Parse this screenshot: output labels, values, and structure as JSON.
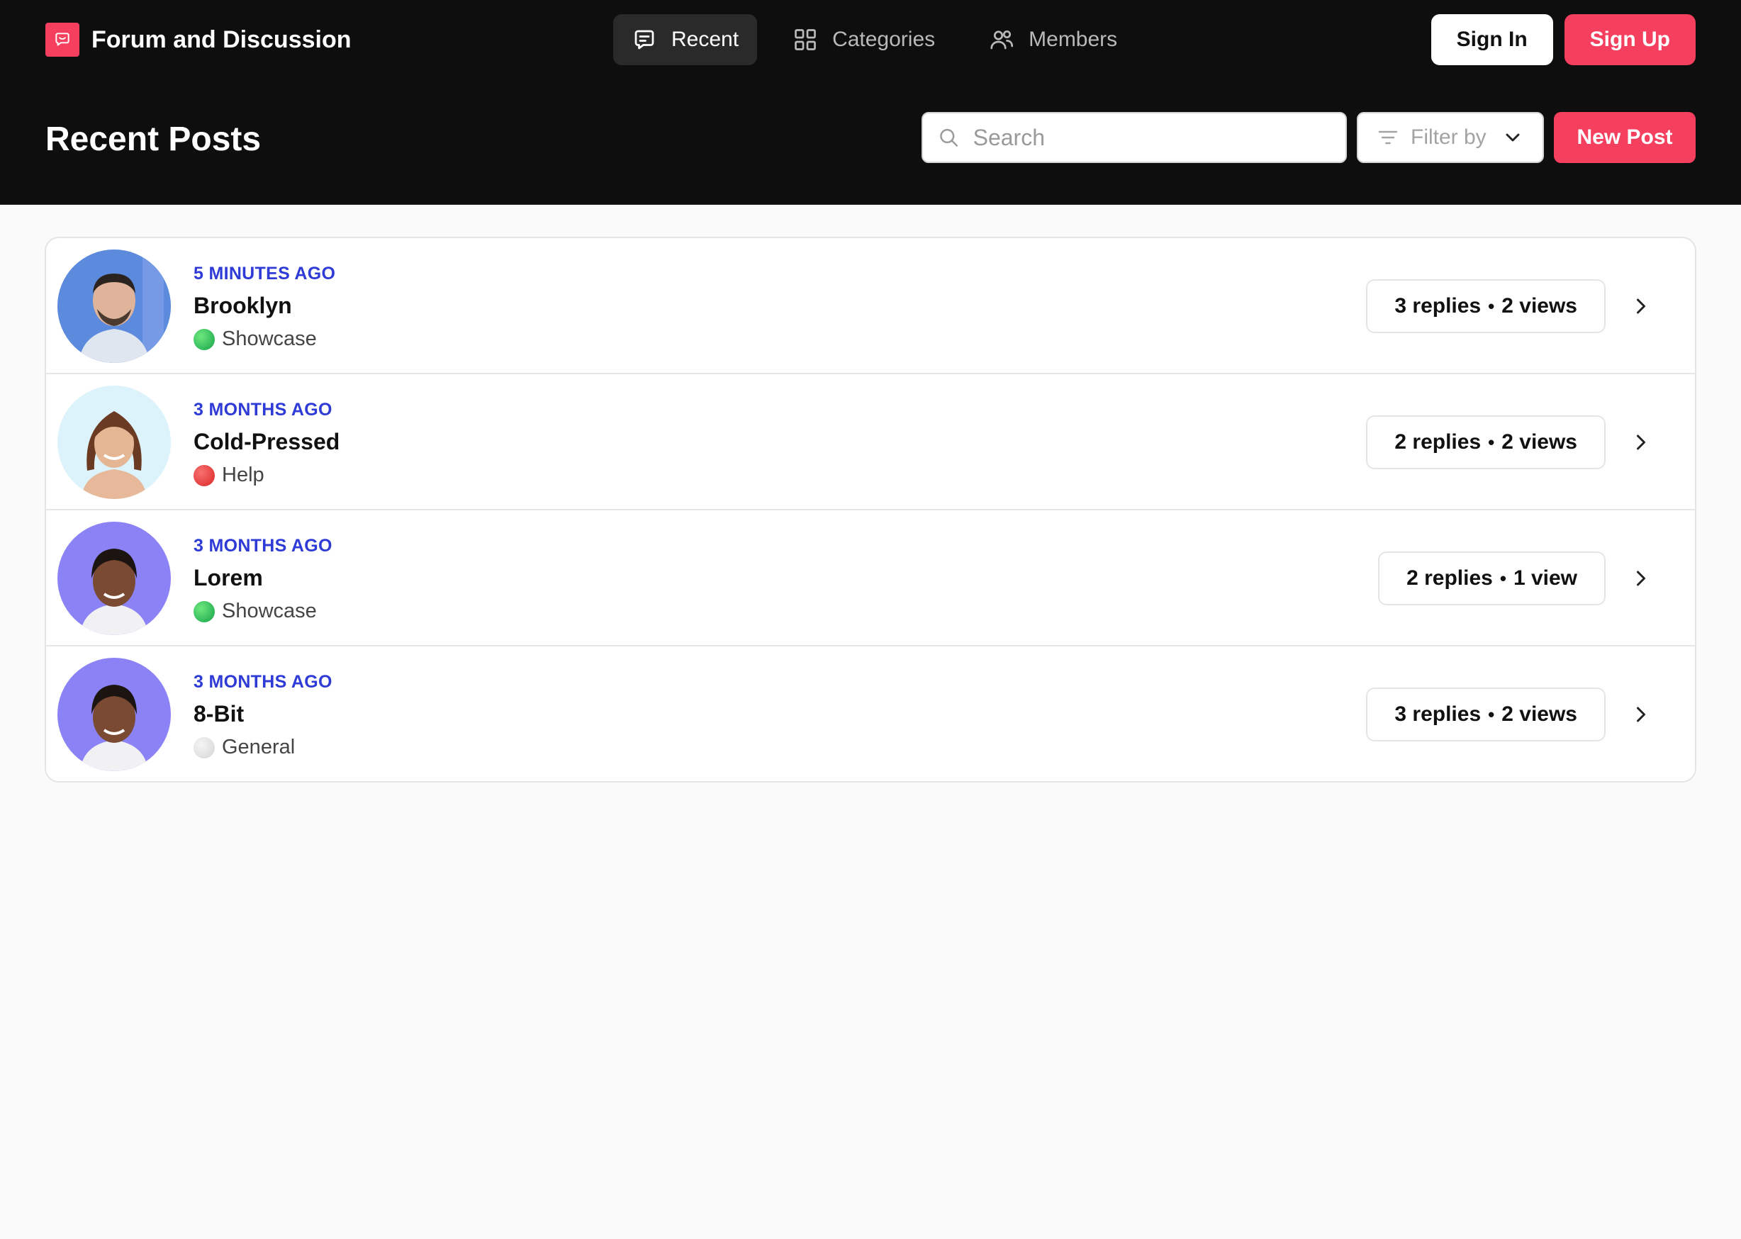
{
  "app": {
    "title": "Forum and Discussion",
    "logo_icon": "chat-bubble-icon",
    "accent_color": "#f43f5e"
  },
  "nav": {
    "items": [
      {
        "label": "Recent",
        "icon": "message-square-icon",
        "active": true
      },
      {
        "label": "Categories",
        "icon": "grid-icon",
        "active": false
      },
      {
        "label": "Members",
        "icon": "users-icon",
        "active": false
      }
    ]
  },
  "auth": {
    "sign_in": "Sign In",
    "sign_up": "Sign Up"
  },
  "header": {
    "title": "Recent Posts",
    "search_placeholder": "Search",
    "search_value": "",
    "filter_label": "Filter by",
    "new_post": "New Post"
  },
  "posts": [
    {
      "time": "5 MINUTES AGO",
      "author": "Brooklyn",
      "category": "Showcase",
      "category_color": "#22c55e",
      "replies": "3 replies",
      "views": "2 views",
      "avatar_bg": "#4f7fd6"
    },
    {
      "time": "3 MONTHS AGO",
      "author": "Cold-Pressed",
      "category": "Help",
      "category_color": "#ef4444",
      "replies": "2 replies",
      "views": "2 views",
      "avatar_bg": "#dcf3fb"
    },
    {
      "time": "3 MONTHS AGO",
      "author": "Lorem",
      "category": "Showcase",
      "category_color": "#22c55e",
      "replies": "2 replies",
      "views": "1 view",
      "avatar_bg": "#8b83f5"
    },
    {
      "time": "3 MONTHS AGO",
      "author": "8-Bit",
      "category": "General",
      "category_color": "#e5e5e5",
      "replies": "3 replies",
      "views": "2 views",
      "avatar_bg": "#8b83f5"
    }
  ],
  "stats_separator": "•"
}
